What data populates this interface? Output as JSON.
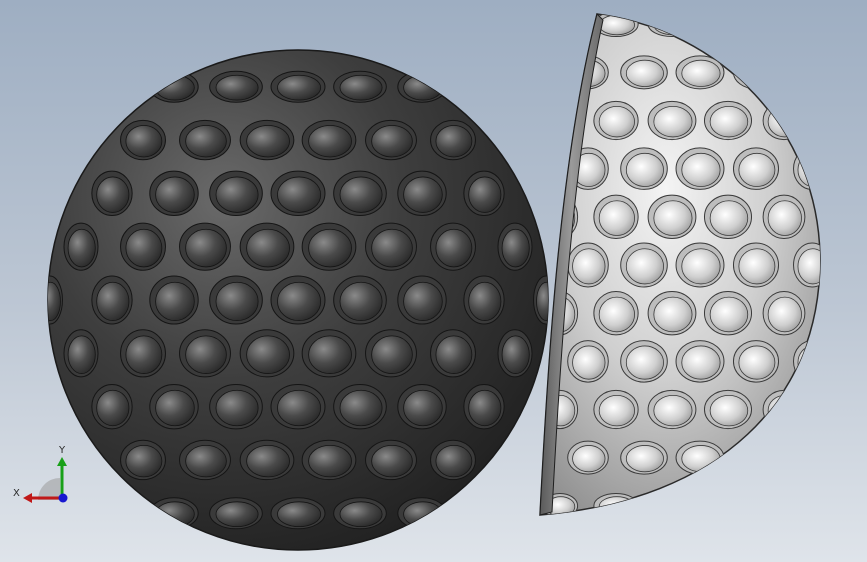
{
  "viewport": {
    "background_top": "#9eaec2",
    "background_bottom": "#dfe4ea"
  },
  "model": {
    "dark_ball_color": "#3c3c3c",
    "light_half_color": "#c8c8c8"
  },
  "triad": {
    "x_label": "X",
    "y_label": "Y",
    "x_color": "#c01818",
    "y_color": "#18a018",
    "z_color": "#1818d0"
  }
}
